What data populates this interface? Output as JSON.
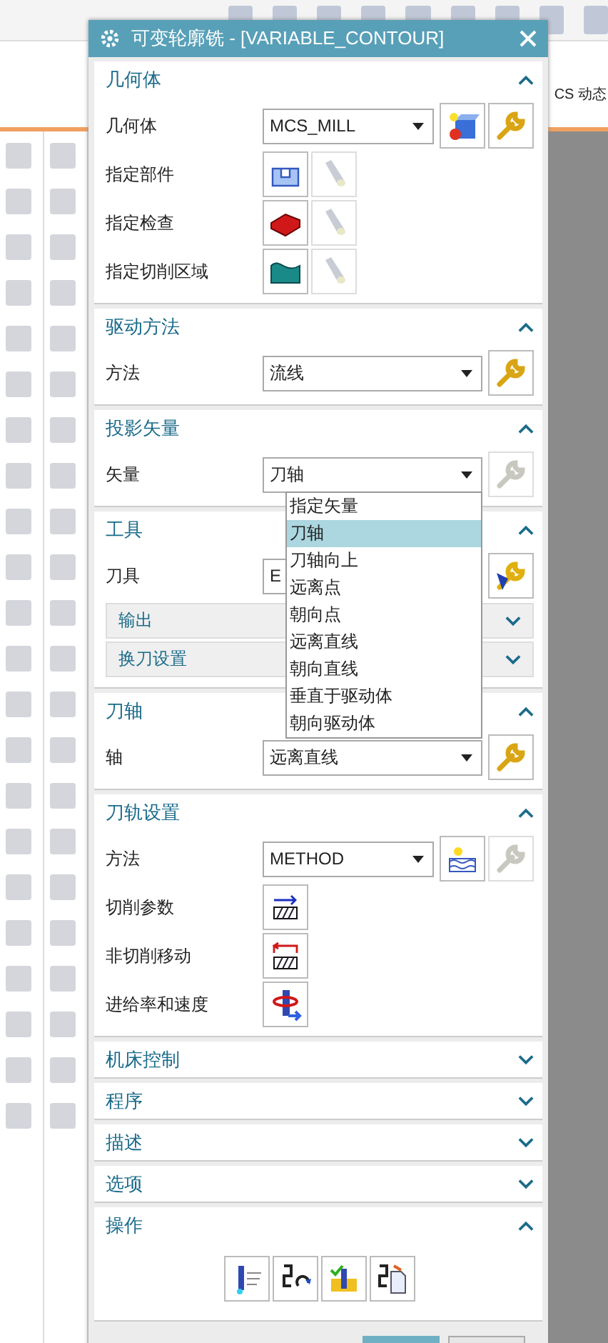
{
  "app": {
    "ribbon_label": "CS 动态"
  },
  "dialog": {
    "title": "可变轮廓铣 - [VARIABLE_CONTOUR]",
    "sections": [
      {
        "title": "几何体",
        "expanded": true,
        "rows": [
          {
            "kind": "select",
            "label": "几何体",
            "value": "MCS_MILL",
            "buttons": [
              {
                "kind": "geometry",
                "disabled": false
              },
              {
                "kind": "wrench",
                "disabled": false
              }
            ]
          },
          {
            "kind": "action",
            "label": "指定部件",
            "buttons": [
              {
                "kind": "part",
                "disabled": false
              },
              {
                "kind": "flashlight",
                "disabled": true
              }
            ]
          },
          {
            "kind": "action",
            "label": "指定检查",
            "buttons": [
              {
                "kind": "check",
                "disabled": false
              },
              {
                "kind": "flashlight",
                "disabled": true
              }
            ]
          },
          {
            "kind": "action",
            "label": "指定切削区域",
            "buttons": [
              {
                "kind": "area",
                "disabled": false
              },
              {
                "kind": "flashlight",
                "disabled": true
              }
            ]
          }
        ]
      },
      {
        "title": "驱动方法",
        "expanded": true,
        "rows": [
          {
            "kind": "select",
            "label": "方法",
            "value": "流线",
            "buttons": [
              {
                "kind": "wrench",
                "disabled": false
              }
            ]
          }
        ]
      },
      {
        "title": "投影矢量",
        "expanded": true,
        "rows": [
          {
            "kind": "select",
            "label": "矢量",
            "value": "刀轴",
            "buttons": [
              {
                "kind": "wrench",
                "disabled": true
              }
            ],
            "options": [
              {
                "label": "指定矢量",
                "selected": false
              },
              {
                "label": "刀轴",
                "selected": true
              },
              {
                "label": "刀轴向上",
                "selected": false
              },
              {
                "label": "远离点",
                "selected": false
              },
              {
                "label": "朝向点",
                "selected": false
              },
              {
                "label": "远离直线",
                "selected": false
              },
              {
                "label": "朝向直线",
                "selected": false
              },
              {
                "label": "垂直于驱动体",
                "selected": false
              },
              {
                "label": "朝向驱动体",
                "selected": false
              }
            ]
          }
        ]
      },
      {
        "title": "工具",
        "expanded": true,
        "rows": [
          {
            "kind": "select",
            "label": "刀具",
            "value": "E",
            "buttons": [
              {
                "kind": "tool",
                "disabled": false
              }
            ]
          },
          {
            "kind": "group",
            "title": "输出",
            "expanded": false
          },
          {
            "kind": "group",
            "title": "换刀设置",
            "expanded": false
          }
        ]
      },
      {
        "title": "刀轴",
        "expanded": true,
        "rows": [
          {
            "kind": "select",
            "label": "轴",
            "value": "远离直线",
            "buttons": [
              {
                "kind": "wrench",
                "disabled": false
              }
            ]
          }
        ]
      },
      {
        "title": "刀轨设置",
        "expanded": true,
        "rows": [
          {
            "kind": "select",
            "label": "方法",
            "value": "METHOD",
            "buttons": [
              {
                "kind": "method",
                "disabled": false
              },
              {
                "kind": "wrench",
                "disabled": true
              }
            ]
          },
          {
            "kind": "action",
            "label": "切削参数",
            "buttons": [
              {
                "kind": "cut",
                "disabled": false
              }
            ]
          },
          {
            "kind": "action",
            "label": "非切削移动",
            "buttons": [
              {
                "kind": "noncut",
                "disabled": false
              }
            ]
          },
          {
            "kind": "action",
            "label": "进给率和速度",
            "buttons": [
              {
                "kind": "feed",
                "disabled": false
              }
            ]
          }
        ]
      },
      {
        "title": "机床控制",
        "expanded": false
      },
      {
        "title": "程序",
        "expanded": false
      },
      {
        "title": "描述",
        "expanded": false
      },
      {
        "title": "选项",
        "expanded": false
      },
      {
        "title": "操作",
        "expanded": true,
        "rows": [
          {
            "kind": "toolbar",
            "buttons": [
              {
                "kind": "generate",
                "disabled": false
              },
              {
                "kind": "replay",
                "disabled": false
              },
              {
                "kind": "verify",
                "disabled": false
              },
              {
                "kind": "list",
                "disabled": false
              }
            ]
          }
        ]
      }
    ]
  }
}
